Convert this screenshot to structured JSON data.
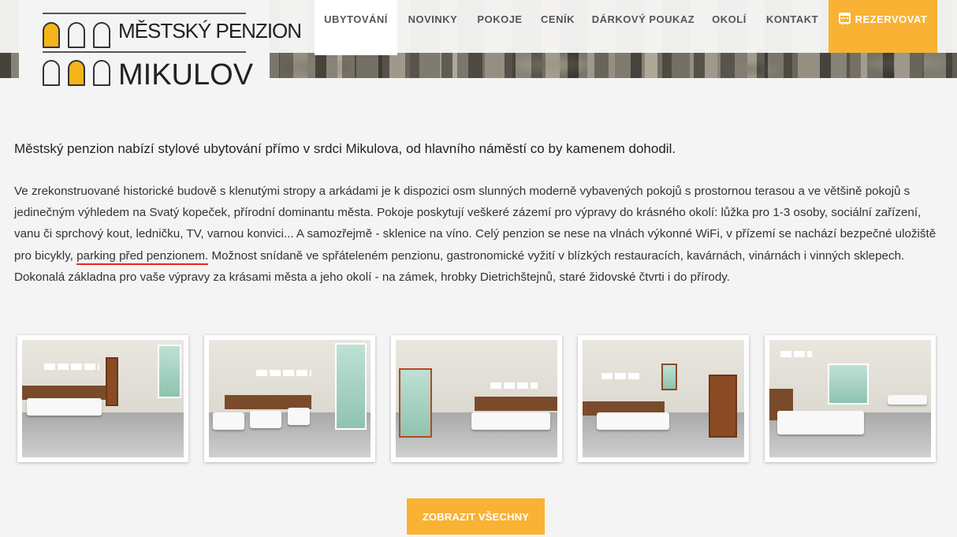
{
  "logo": {
    "line1": "MĚSTSKÝ PENZION",
    "line2": "MIKULOV"
  },
  "nav": {
    "items": [
      "UBYTOVÁNÍ",
      "NOVINKY",
      "POKOJE",
      "CENÍK",
      "DÁRKOVÝ POUKAZ",
      "OKOLÍ",
      "KONTAKT"
    ],
    "active": "UBYTOVÁNÍ",
    "reserve_label": "REZERVOVAT",
    "reserve_icon": "calendar-icon"
  },
  "content": {
    "lead": "Městský penzion nabízí stylové ubytování přímo v srdci Mikulova, od hlavního náměstí co by kamenem dohodil.",
    "body_before": "Ve zrekonstruované historické budově s klenutými stropy a arkádami je k dispozici osm slunných moderně vybavených pokojů s prostornou terasou a ve většině pokojů s jedinečným výhledem na Svatý kopeček, přírodní dominantu města. Pokoje poskytují veškeré zázemí pro výpravy do krásného okolí: lůžka pro 1-3 osoby, sociální zařízení, vanu či sprchový kout, ledničku, TV, varnou konvici... A samozřejmě - sklenice na víno. Celý penzion se nese na vlnách výkonné WiFi, v přízemí se nachází bezpečné uložiště pro bicykly, ",
    "body_highlight": "parking před penzionem.",
    "body_after": " Možnost snídaně ve spřáteleném penzionu, gastronomické vyžití v blízkých restauracích, kavárnách, vinárnách i vinných sklepech. Dokonalá základna pro vaše výpravy za krásami města a jeho okolí - na zámek, hrobky Dietrichštejnů, staré židovské čtvrti i do přírody."
  },
  "gallery": {
    "count": 5
  },
  "cta": {
    "label": "ZOBRAZIT VŠECHNY"
  },
  "colors": {
    "accent": "#f9b233",
    "highlight_underline": "#ee2222"
  }
}
